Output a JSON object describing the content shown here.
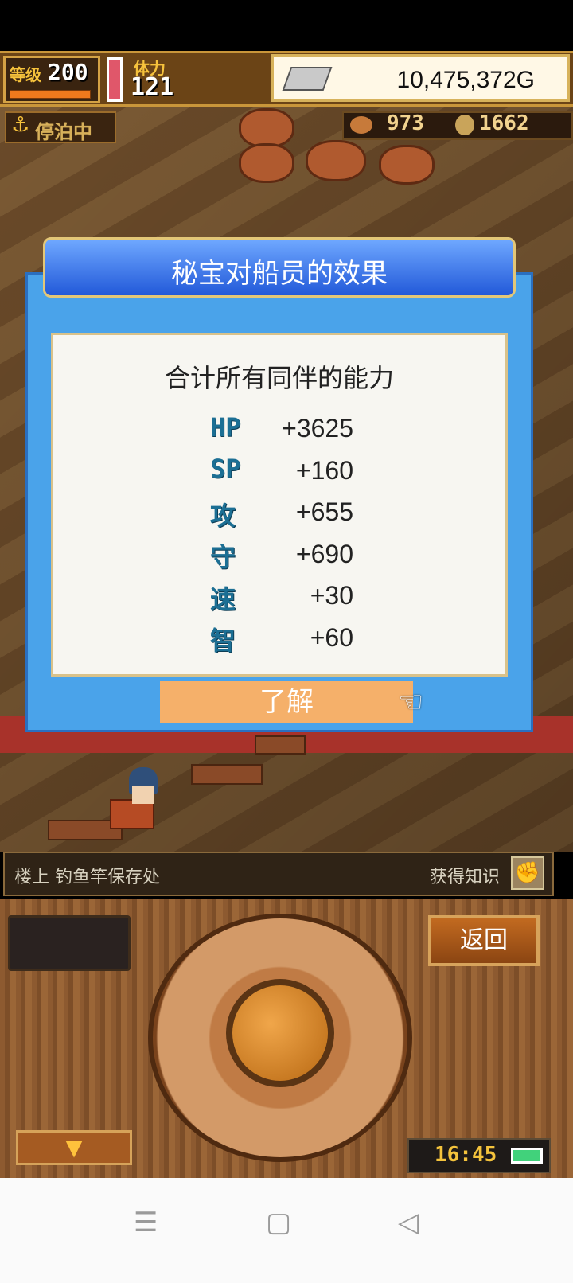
{
  "hud": {
    "level_label": "等级",
    "level_value": "200",
    "stamina_label": "体力",
    "stamina_value": "121",
    "money": "10,475,372G",
    "anchor_icon": "anchor-icon",
    "anchored_label": "停泊中",
    "food_count": "973",
    "medal_count": "1662"
  },
  "dialog": {
    "title": "秘宝对船员的效果",
    "heading": "合计所有同伴的能力",
    "stats": [
      {
        "label": "HP",
        "value": "+3625"
      },
      {
        "label": "SP",
        "value": "+160"
      },
      {
        "label": "攻",
        "value": "+655"
      },
      {
        "label": "守",
        "value": "+690"
      },
      {
        "label": "速",
        "value": "+30"
      },
      {
        "label": "智",
        "value": "+60"
      }
    ],
    "ok_label": "了解"
  },
  "location": {
    "place": "楼上 钓鱼竿保存处",
    "knowledge_label": "获得知识"
  },
  "controls": {
    "back_label": "返回",
    "down_arrow": "▼",
    "clock": "16:45"
  },
  "navbar": {
    "menu_icon": "☰",
    "home_icon": "▢",
    "back_icon": "◁"
  },
  "colors": {
    "dialog_blue": "#4aa3ea",
    "title_blue": "#2259d9",
    "ok_orange": "#f5b06a",
    "stat_teal": "#1c6f94"
  }
}
